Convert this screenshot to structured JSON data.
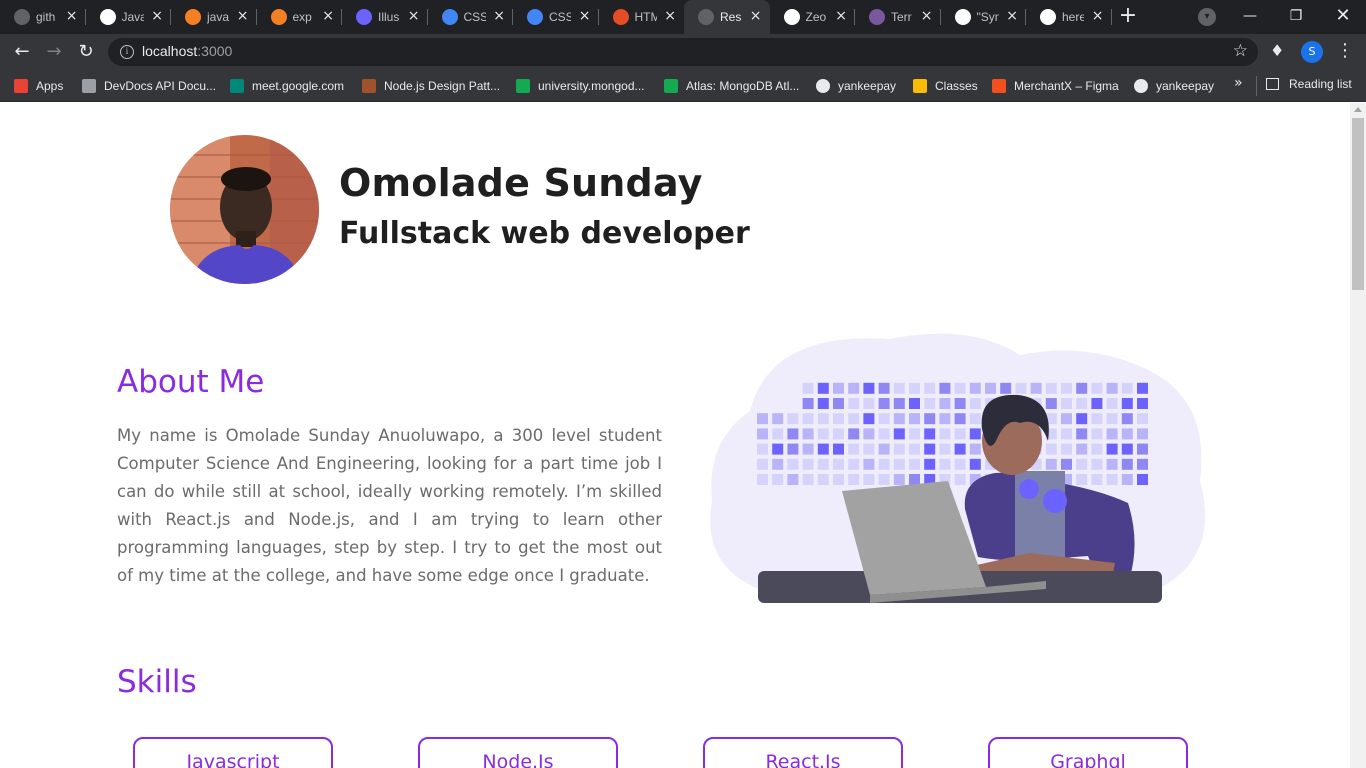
{
  "browser": {
    "tabs": [
      {
        "label": "gith",
        "icon": "github-icon",
        "color": "#5f6368"
      },
      {
        "label": "Java",
        "icon": "github-icon",
        "color": "#ffffff"
      },
      {
        "label": "java",
        "icon": "stackoverflow-icon",
        "color": "#f48024"
      },
      {
        "label": "exp",
        "icon": "stackoverflow-icon",
        "color": "#f48024"
      },
      {
        "label": "Illus",
        "icon": "illustration-site-icon",
        "color": "#6c63ff"
      },
      {
        "label": "CSS",
        "icon": "css-doc-icon",
        "color": "#4285f4"
      },
      {
        "label": "CSS",
        "icon": "css-doc-icon",
        "color": "#4285f4"
      },
      {
        "label": "HTM",
        "icon": "html-icon",
        "color": "#e44d26"
      },
      {
        "label": "Resu",
        "icon": "globe-icon",
        "color": "#5f6368"
      },
      {
        "label": "Zeo",
        "icon": "github-icon",
        "color": "#ffffff"
      },
      {
        "label": "Terr",
        "icon": "heroku-icon",
        "color": "#79589f"
      },
      {
        "label": "\"Syn",
        "icon": "github-icon",
        "color": "#ffffff"
      },
      {
        "label": "here",
        "icon": "google-icon",
        "color": "#ffffff"
      }
    ],
    "active_tab_index": 8,
    "url_host": "localhost",
    "url_port": ":3000",
    "profile_initial": "S",
    "bookmarks": [
      {
        "label": "Apps",
        "icon": "apps-grid-icon"
      },
      {
        "label": "DevDocs API Docu...",
        "icon": "devdocs-icon"
      },
      {
        "label": "meet.google.com",
        "icon": "google-meet-icon"
      },
      {
        "label": "Node.js Design Patt...",
        "icon": "book-icon"
      },
      {
        "label": "university.mongod...",
        "icon": "mongodb-leaf-icon"
      },
      {
        "label": "Atlas: MongoDB Atl...",
        "icon": "mongodb-leaf-icon"
      },
      {
        "label": "yankeepay",
        "icon": "globe-icon"
      },
      {
        "label": "Classes",
        "icon": "google-classroom-icon"
      },
      {
        "label": "MerchantX – Figma",
        "icon": "figma-icon"
      },
      {
        "label": "yankeepay",
        "icon": "globe-icon"
      }
    ],
    "bookmarks_overflow": "»",
    "reading_list": "Reading list"
  },
  "profile": {
    "name": "Omolade Sunday",
    "role": "Fullstack web developer"
  },
  "about": {
    "title": "About Me",
    "text": "My name is Omolade Sunday Anuoluwapo, a 300 level student Computer Science And Engineering, looking for a part time job I can do while still at school, ideally working remotely. I’m skilled with React.js and Node.js, and I am trying to learn other programming languages, step by step. I try to get the most out of my time at the college, and have some edge once I graduate."
  },
  "skills": {
    "title": "Skills",
    "items": [
      "Javascript",
      "Node.Js",
      "React.Js",
      "Graphql"
    ]
  },
  "colors": {
    "accent": "#8a2be2",
    "illustration_primary": "#6c63ff"
  }
}
